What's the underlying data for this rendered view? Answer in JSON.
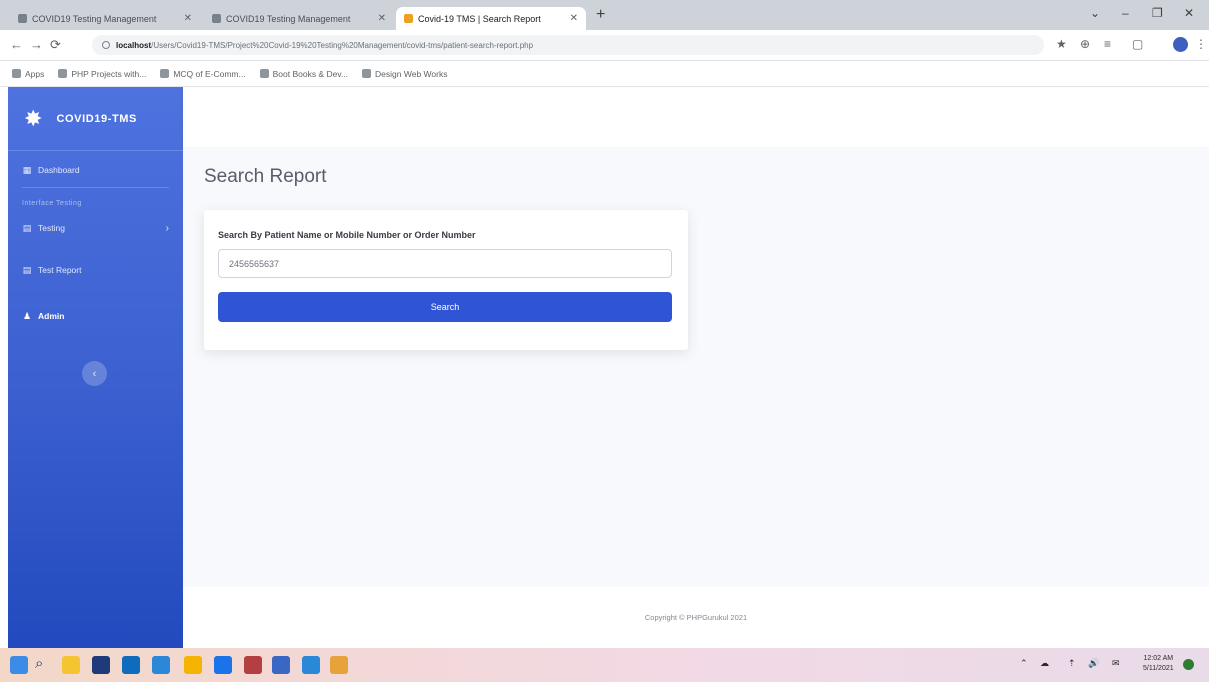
{
  "browser": {
    "tabs": [
      {
        "title": "COVID19 Testing Management",
        "active": false
      },
      {
        "title": "COVID19 Testing Management",
        "active": false
      },
      {
        "title": "Covid-19 TMS | Search Report",
        "active": true
      }
    ],
    "new_tab_glyph": "+",
    "nav": {
      "back": "←",
      "forward": "→",
      "reload": "⟳"
    },
    "url_host": "localhost",
    "url_rest": "/Users/Covid19-TMS/Project%20Covid-19%20Testing%20Management/covid-tms/patient-search-report.php",
    "bookmarks": [
      "Apps",
      "PHP Projects with...",
      "MCQ of E-Comm...",
      "Boot Books & Dev...",
      "Design Web Works"
    ],
    "window_controls": [
      "⌄",
      "–",
      "❐",
      "✕"
    ],
    "tool_icons": [
      "★",
      "⊕",
      "≡",
      "▢",
      "⋮"
    ]
  },
  "sidebar": {
    "brand": "COVID19-TMS",
    "brand_icon": "✸",
    "items": [
      {
        "label": "Dashboard",
        "icon": "▦"
      },
      {
        "label": "Testing",
        "icon": "▤"
      },
      {
        "label": "Test Report",
        "icon": "▤"
      },
      {
        "label": "Admin",
        "icon": "♟"
      }
    ],
    "heading": "Interface Testing",
    "toggle_icon": "‹"
  },
  "main": {
    "title": "Search Report",
    "search": {
      "label": "Search By Patient Name or Mobile Number or Order Number",
      "value": "2456565637",
      "button": "Search"
    }
  },
  "footer": {
    "text": "Copyright © PHPGurukul 2021"
  },
  "taskbar": {
    "apps": [
      "#3c8ce7",
      "#f4c431",
      "#1f3a7a",
      "#0f6cbd",
      "#2b88d8",
      "#f4b400",
      "#1a73e8",
      "#b33f40",
      "#3a66c4",
      "#2b88d8",
      "#e8a23a"
    ],
    "tray": [
      "⌃",
      "☁",
      "⇡",
      "🔊",
      "✉"
    ],
    "time": "12:02 AM",
    "date": "5/11/2021"
  }
}
